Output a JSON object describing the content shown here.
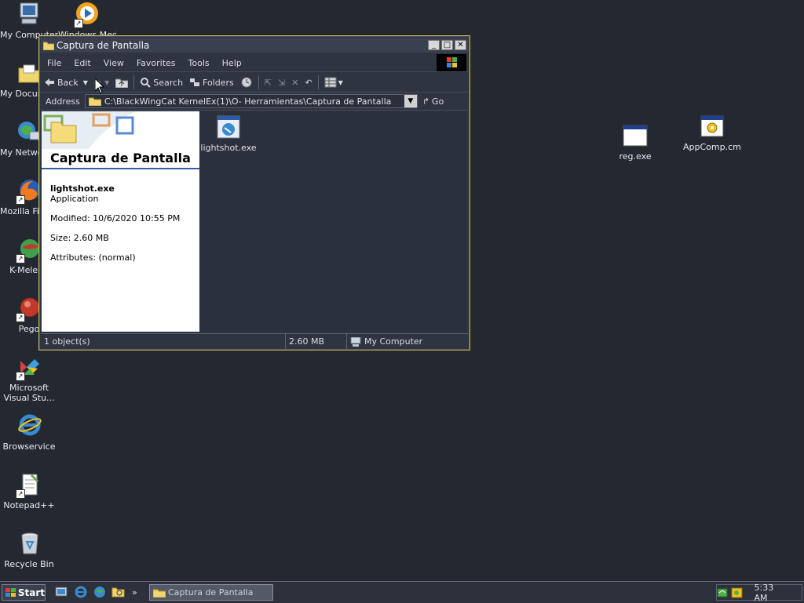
{
  "desktop": {
    "icons": [
      {
        "label": "My Computer"
      },
      {
        "label": "Windows Media Player"
      },
      {
        "label": "My Documents"
      },
      {
        "label": "My Network Places"
      },
      {
        "label": "Mozilla Firefox"
      },
      {
        "label": "K-Meleon"
      },
      {
        "label": "Pego"
      },
      {
        "label": "Microsoft Visual Stu..."
      },
      {
        "label": "Browservice"
      },
      {
        "label": "Notepad++"
      },
      {
        "label": "Recycle Bin"
      },
      {
        "label": "reg.exe"
      },
      {
        "label": "AppComp.cmd"
      }
    ]
  },
  "window": {
    "title": "Captura de Pantalla",
    "menu": [
      "File",
      "Edit",
      "View",
      "Favorites",
      "Tools",
      "Help"
    ],
    "toolbar": {
      "back": "Back",
      "search": "Search",
      "folders": "Folders"
    },
    "address": {
      "label": "Address",
      "value": "C:\\BlackWingCat KernelEx(1)\\O- Herramientas\\Captura de Pantalla",
      "go": "Go"
    },
    "left_pane": {
      "title": "Captura de Pantalla",
      "file_name": "lightshot.exe",
      "file_type": "Application",
      "modified": "Modified: 10/6/2020 10:55 PM",
      "size": "Size: 2.60 MB",
      "attributes": "Attributes: (normal)"
    },
    "files": [
      {
        "label": "lightshot.exe"
      }
    ],
    "status": {
      "objects": "1 object(s)",
      "size": "2.60 MB",
      "location": "My Computer"
    }
  },
  "taskbar": {
    "start": "Start",
    "task": "Captura de Pantalla",
    "clock": "5:33 AM",
    "chevron": "»"
  },
  "colors": {
    "accent": "#c8b35a",
    "desktop": "#232831",
    "info_rule": "#2f5f9f"
  }
}
